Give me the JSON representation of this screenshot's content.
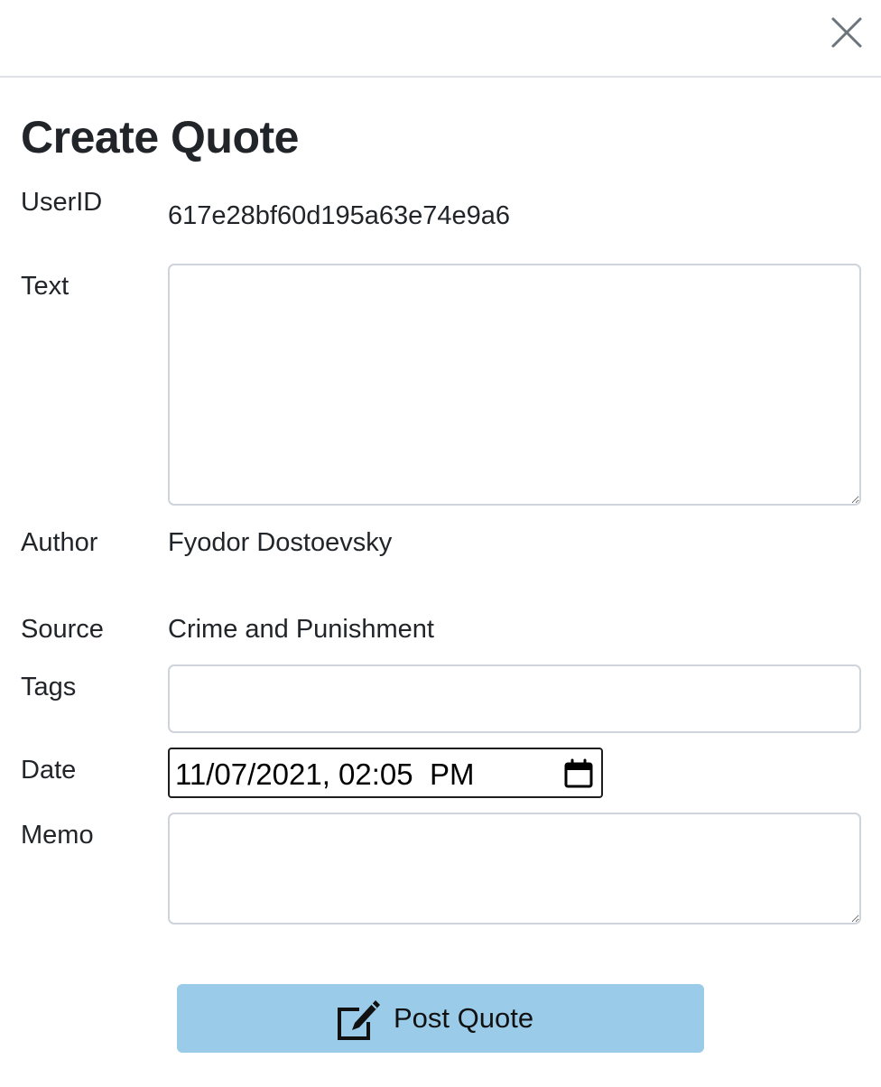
{
  "header": {
    "close_icon": "close-icon"
  },
  "form": {
    "title": "Create Quote",
    "userid": {
      "label": "UserID",
      "value": "617e28bf60d195a63e74e9a6"
    },
    "text": {
      "label": "Text",
      "value": ""
    },
    "author": {
      "label": "Author",
      "value": "Fyodor Dostoevsky"
    },
    "source": {
      "label": "Source",
      "value": "Crime and Punishment"
    },
    "tags": {
      "label": "Tags",
      "value": ""
    },
    "date": {
      "label": "Date",
      "value": "11/07/2021, 02:05  PM",
      "icon": "calendar-icon"
    },
    "memo": {
      "label": "Memo",
      "value": ""
    }
  },
  "submit": {
    "label": "Post Quote",
    "icon": "edit-pen-icon",
    "color": "#9acbe9"
  }
}
